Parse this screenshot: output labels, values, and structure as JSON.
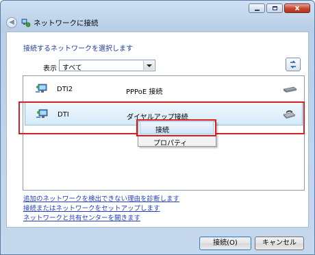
{
  "window": {
    "title": "ネットワークに接続",
    "caption_buttons": {
      "minimize_icon": "minimize-icon",
      "maximize_icon": "maximize-icon",
      "close_icon": "close-icon",
      "close_glyph": "x"
    }
  },
  "content": {
    "heading": "接続するネットワークを選択します",
    "show_label": "表示",
    "filter": {
      "selected": "すべて"
    },
    "networks": [
      {
        "name": "DTI2",
        "type": "PPPoE 接続",
        "device_icon": "broadband-device-icon"
      },
      {
        "name": "DTI",
        "type": "ダイヤルアップ接続",
        "device_icon": "modem-phone-icon"
      }
    ],
    "context_menu": {
      "items": [
        "接続",
        "プロパティ"
      ]
    },
    "links": [
      "追加のネットワークを検出できない理由を診断します",
      "接続またはネットワークをセットアップします",
      "ネットワークと共有センターを開きます"
    ]
  },
  "buttons": {
    "connect": "接続(O)",
    "cancel": "キャンセル"
  },
  "colors": {
    "highlight_frame": "#d81e1e",
    "heading": "#1e3c94",
    "link": "#1f3fbf"
  }
}
